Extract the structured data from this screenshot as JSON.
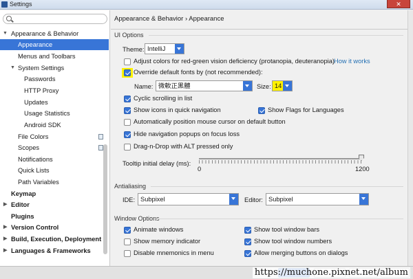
{
  "window": {
    "title": "Settings"
  },
  "search": {
    "placeholder": ""
  },
  "sidebar": {
    "items": [
      {
        "label": "Appearance & Behavior",
        "level": 0,
        "expanded": true,
        "bold": false
      },
      {
        "label": "Appearance",
        "level": 1,
        "selected": true
      },
      {
        "label": "Menus and Toolbars",
        "level": 1
      },
      {
        "label": "System Settings",
        "level": 1,
        "expanded": true
      },
      {
        "label": "Passwords",
        "level": 2
      },
      {
        "label": "HTTP Proxy",
        "level": 2
      },
      {
        "label": "Updates",
        "level": 2
      },
      {
        "label": "Usage Statistics",
        "level": 2
      },
      {
        "label": "Android SDK",
        "level": 2
      },
      {
        "label": "File Colors",
        "level": 1,
        "page_icon": true
      },
      {
        "label": "Scopes",
        "level": 1,
        "page_icon": true
      },
      {
        "label": "Notifications",
        "level": 1
      },
      {
        "label": "Quick Lists",
        "level": 1
      },
      {
        "label": "Path Variables",
        "level": 1
      },
      {
        "label": "Keymap",
        "level": 0,
        "bold": true
      },
      {
        "label": "Editor",
        "level": 0,
        "bold": true,
        "collapsed": true
      },
      {
        "label": "Plugins",
        "level": 0,
        "bold": true
      },
      {
        "label": "Version Control",
        "level": 0,
        "bold": true,
        "collapsed": true
      },
      {
        "label": "Build, Execution, Deployment",
        "level": 0,
        "bold": true,
        "collapsed": true
      },
      {
        "label": "Languages & Frameworks",
        "level": 0,
        "bold": true,
        "collapsed": true
      }
    ]
  },
  "main": {
    "breadcrumb": "Appearance & Behavior › Appearance",
    "ui_options": {
      "title": "UI Options",
      "theme_label": "Theme:",
      "theme_value": "IntelliJ",
      "adjust_colors_label": "Adjust colors for red-green vision deficiency (protanopia, deuteranopia)",
      "adjust_colors_checked": false,
      "how_it_works_link": "How it works",
      "override_fonts_label": "Override default fonts by (not recommended):",
      "override_fonts_checked": true,
      "name_label": "Name:",
      "name_value": "微軟正黑體",
      "size_label": "Size:",
      "size_value": "14",
      "cyclic_scrolling_label": "Cyclic scrolling in list",
      "cyclic_scrolling_checked": true,
      "show_icons_label": "Show icons in quick navigation",
      "show_icons_checked": true,
      "show_flags_label": "Show Flags for Languages",
      "show_flags_checked": true,
      "auto_position_label": "Automatically position mouse cursor on default button",
      "auto_position_checked": false,
      "hide_nav_popups_label": "Hide navigation popups on focus loss",
      "hide_nav_popups_checked": true,
      "drag_alt_label": "Drag-n-Drop with ALT pressed only",
      "drag_alt_checked": false,
      "tooltip_delay_label": "Tooltip initial delay (ms):",
      "tooltip_delay_min": "0",
      "tooltip_delay_max": "1200",
      "tooltip_delay_value": 1200
    },
    "antialiasing": {
      "title": "Antialiasing",
      "ide_label": "IDE:",
      "ide_value": "Subpixel",
      "editor_label": "Editor:",
      "editor_value": "Subpixel"
    },
    "window_options": {
      "title": "Window Options",
      "animate_windows_label": "Animate windows",
      "animate_windows_checked": true,
      "show_memory_label": "Show memory indicator",
      "show_memory_checked": false,
      "disable_mnemonics_label": "Disable mnemonics in menu",
      "disable_mnemonics_checked": false,
      "show_tool_bars_label": "Show tool window bars",
      "show_tool_bars_checked": true,
      "show_tool_numbers_label": "Show tool window numbers",
      "show_tool_numbers_checked": true,
      "allow_merging_label": "Allow merging buttons on dialogs",
      "allow_merging_checked": true
    }
  },
  "watermark": "https://muchone.pixnet.net/album",
  "colors": {
    "accent": "#3875d7",
    "highlight": "#fff200",
    "link": "#2470b3"
  }
}
